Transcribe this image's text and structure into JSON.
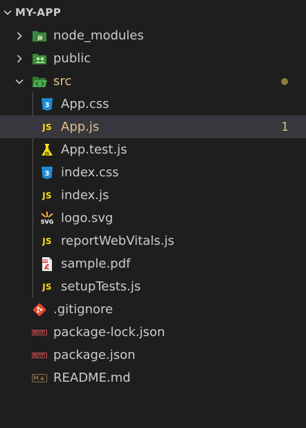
{
  "explorer": {
    "title": "MY-APP"
  },
  "tree": {
    "node_modules": {
      "label": "node_modules"
    },
    "public": {
      "label": "public"
    },
    "src": {
      "label": "src"
    },
    "app_css": {
      "label": "App.css"
    },
    "app_js": {
      "label": "App.js",
      "problems": "1"
    },
    "app_test_js": {
      "label": "App.test.js"
    },
    "index_css": {
      "label": "index.css"
    },
    "index_js": {
      "label": "index.js"
    },
    "logo_svg": {
      "label": "logo.svg"
    },
    "report_web_vitals": {
      "label": "reportWebVitals.js"
    },
    "sample_pdf": {
      "label": "sample.pdf"
    },
    "setup_tests": {
      "label": "setupTests.js"
    },
    "gitignore": {
      "label": ".gitignore"
    },
    "package_lock": {
      "label": "package-lock.json"
    },
    "package_json": {
      "label": "package.json"
    },
    "readme": {
      "label": "README.md"
    }
  },
  "icons": {
    "js_text": "JS",
    "svg_text": "SVG",
    "pdf_text": "PDF"
  },
  "colors": {
    "background": "#1e1e1e",
    "selected_row": "#37373d",
    "modified_text": "#e2c08d",
    "js_icon": "#f5de19",
    "css_icon": "#1f8ad2",
    "folder_green": "#3b9b3b",
    "git_icon": "#e64a2e",
    "json_icon": "#c94b4b"
  }
}
